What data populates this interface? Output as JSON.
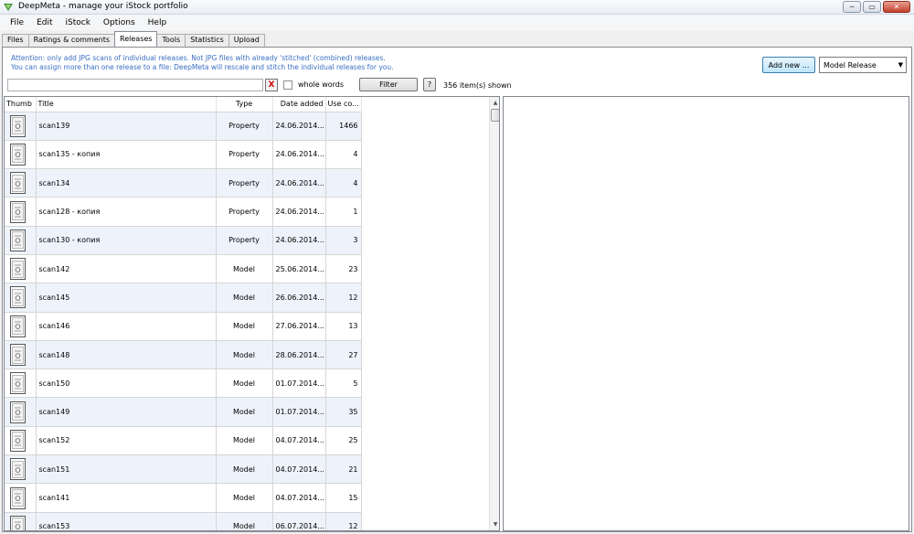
{
  "window": {
    "title": "DeepMeta - manage your iStock portfolio"
  },
  "menu": [
    "File",
    "Edit",
    "iStock",
    "Options",
    "Help"
  ],
  "tabs": [
    "Files",
    "Ratings & comments",
    "Releases",
    "Tools",
    "Statistics",
    "Upload"
  ],
  "active_tab": "Releases",
  "attention": {
    "line1": "Attention: only add JPG scans of individual releases. Not JPG files with already 'stitched' (combined) releases.",
    "line2": "You can assign more than one release to a file: DeepMeta will rescale and stitch the individual releases for you."
  },
  "add_new_label": "Add new ...",
  "release_type": {
    "selected": "Model Release"
  },
  "filter": {
    "search_value": "",
    "clear_label": "X",
    "whole_words_label": "whole words",
    "whole_words_checked": false,
    "button_label": "Filter",
    "help_label": "?",
    "count_text": "356 item(s) shown"
  },
  "columns": [
    "Thumb",
    "Title",
    "Type",
    "Date added",
    "Use co..."
  ],
  "rows": [
    {
      "title": "scan139",
      "type": "Property",
      "date": "24.06.2014...",
      "use": "1466"
    },
    {
      "title": "scan135 - копия",
      "type": "Property",
      "date": "24.06.2014...",
      "use": "4"
    },
    {
      "title": "scan134",
      "type": "Property",
      "date": "24.06.2014...",
      "use": "4"
    },
    {
      "title": "scan128 - копия",
      "type": "Property",
      "date": "24.06.2014...",
      "use": "1"
    },
    {
      "title": "scan130 - копия",
      "type": "Property",
      "date": "24.06.2014...",
      "use": "3"
    },
    {
      "title": "scan142",
      "type": "Model",
      "date": "25.06.2014...",
      "use": "23"
    },
    {
      "title": "scan145",
      "type": "Model",
      "date": "26.06.2014...",
      "use": "12"
    },
    {
      "title": "scan146",
      "type": "Model",
      "date": "27.06.2014...",
      "use": "13"
    },
    {
      "title": "scan148",
      "type": "Model",
      "date": "28.06.2014...",
      "use": "27"
    },
    {
      "title": "scan150",
      "type": "Model",
      "date": "01.07.2014...",
      "use": "5"
    },
    {
      "title": "scan149",
      "type": "Model",
      "date": "01.07.2014...",
      "use": "35"
    },
    {
      "title": "scan152",
      "type": "Model",
      "date": "04.07.2014...",
      "use": "25"
    },
    {
      "title": "scan151",
      "type": "Model",
      "date": "04.07.2014...",
      "use": "21"
    },
    {
      "title": "scan141",
      "type": "Model",
      "date": "04.07.2014...",
      "use": "15"
    },
    {
      "title": "scan153",
      "type": "Model",
      "date": "06.07.2014...",
      "use": "12"
    }
  ]
}
